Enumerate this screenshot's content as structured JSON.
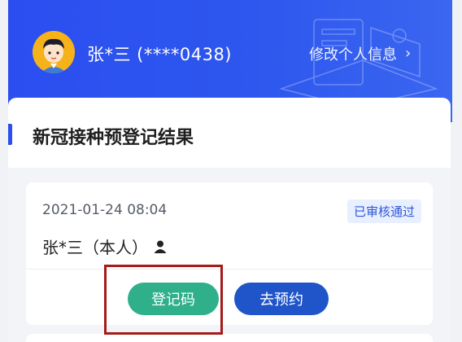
{
  "header": {
    "user_name": "张*三 (****0438)",
    "edit_label": "修改个人信息",
    "edit_chevron": "›",
    "avatar_icon": "user-avatar-icon",
    "bg_color": "#2b4ef0"
  },
  "result": {
    "section_title": "新冠接种预登记结果",
    "record": {
      "datetime": "2021-01-24 08:04",
      "status": "已审核通过",
      "person": "张*三（本人）",
      "person_icon": "person-icon"
    },
    "actions": {
      "code_label": "登记码",
      "book_label": "去预约"
    }
  },
  "colors": {
    "accent_blue": "#2b4ef0",
    "button_green": "#2fb08a",
    "button_blue": "#1f55c9",
    "highlight_red": "#a51b1b"
  }
}
